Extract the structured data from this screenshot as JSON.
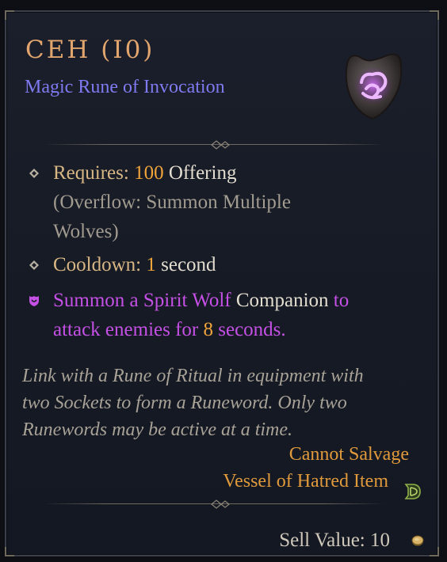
{
  "item": {
    "name": "CEH (I0)",
    "type": "Magic Rune of Invocation"
  },
  "requires": {
    "label": "Requires:",
    "amount": "100",
    "resource": "Offering",
    "overflow_line1": "(Overflow: Summon Multiple",
    "overflow_line2": "Wolves)"
  },
  "cooldown": {
    "label": "Cooldown:",
    "amount": "1",
    "unit": "second"
  },
  "effect": {
    "part1": "Summon a Spirit Wolf ",
    "keyword": "Companion",
    "part2": " to",
    "part3": "attack enemies for ",
    "duration": "8",
    "part4": " seconds."
  },
  "flavor": {
    "line1": "Link with a Rune of Ritual in equipment with",
    "line2": "two Sockets to form a Runeword. Only two",
    "line3": "Runewords may be active at a time."
  },
  "footer": {
    "salvage": "Cannot Salvage",
    "expansion": "Vessel of Hatred Item",
    "expansion_icon_text": "D",
    "sell_label": "Sell Value:",
    "sell_amount": "10"
  },
  "colors": {
    "title": "#e2a56e",
    "magic_type": "#7f7af0",
    "number": "#f0a43a",
    "label": "#d9b784",
    "effect_purple": "#c550e6",
    "flavor_gray": "#a8a297",
    "salvage_orange": "#e09a3c"
  },
  "icons": [
    "rune-item-icon",
    "diamond-bullet-icon",
    "shield-bullet-icon",
    "vessel-of-hatred-icon",
    "gold-coin-icon",
    "divider-ornament-icon"
  ]
}
